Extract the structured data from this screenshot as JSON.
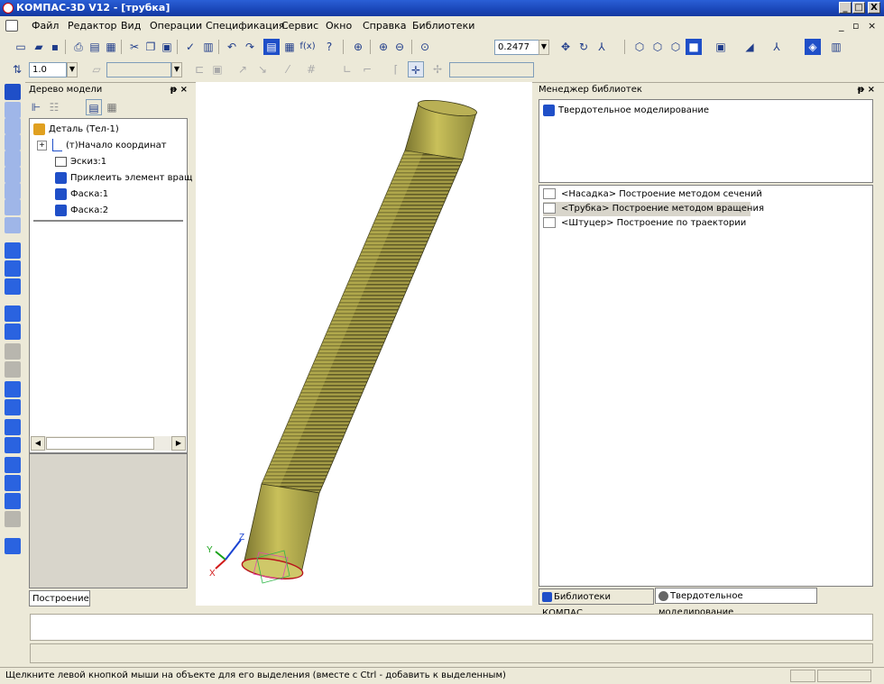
{
  "window": {
    "title": "КОМПАС-3D V12 - [трубка]",
    "btn_min": "_",
    "btn_max": "□",
    "btn_close": "X"
  },
  "menu": {
    "items": [
      "Файл",
      "Редактор",
      "Вид",
      "Операции",
      "Спецификация",
      "Сервис",
      "Окно",
      "Справка",
      "Библиотеки"
    ],
    "doc_controls": "_ ▫ ×"
  },
  "toolbar": {
    "zoom_value": "0.2477",
    "step_value": "1.0"
  },
  "model_tree": {
    "title": "Дерево модели",
    "pin_close": "ᵽ ×",
    "items": [
      {
        "label": "Деталь (Тел-1)"
      },
      {
        "label": "(т)Начало координат"
      },
      {
        "label": "Эскиз:1"
      },
      {
        "label": "Приклеить элемент вращ"
      },
      {
        "label": "Фаска:1"
      },
      {
        "label": "Фаска:2"
      }
    ],
    "tab_label": "Построение"
  },
  "library_manager": {
    "title": "Менеджер библиотек",
    "pin_close": "ᵽ ×",
    "top_item": "Твердотельное моделирование",
    "items": [
      {
        "label": "<Насадка> Построение методом сечений",
        "selected": false
      },
      {
        "label": "<Трубка> Построение методом вращения",
        "selected": true
      },
      {
        "label": "<Штуцер> Построение по траектории",
        "selected": false
      }
    ],
    "tabs": [
      "Библиотеки КОМПАС",
      "Твердотельное моделирование"
    ]
  },
  "axes": {
    "x": "X",
    "y": "Y",
    "z": "Z"
  },
  "statusbar": {
    "text": "Щелкните левой кнопкой мыши на объекте для его выделения (вместе с Ctrl - добавить к выделенным)"
  },
  "colors": {
    "titlebar": "#1a46b8",
    "part_body": "#b5ad4a",
    "part_thread": "#8f8a3c",
    "selection": "#c8c3b4",
    "icon_blue": "#1f4fc8"
  }
}
